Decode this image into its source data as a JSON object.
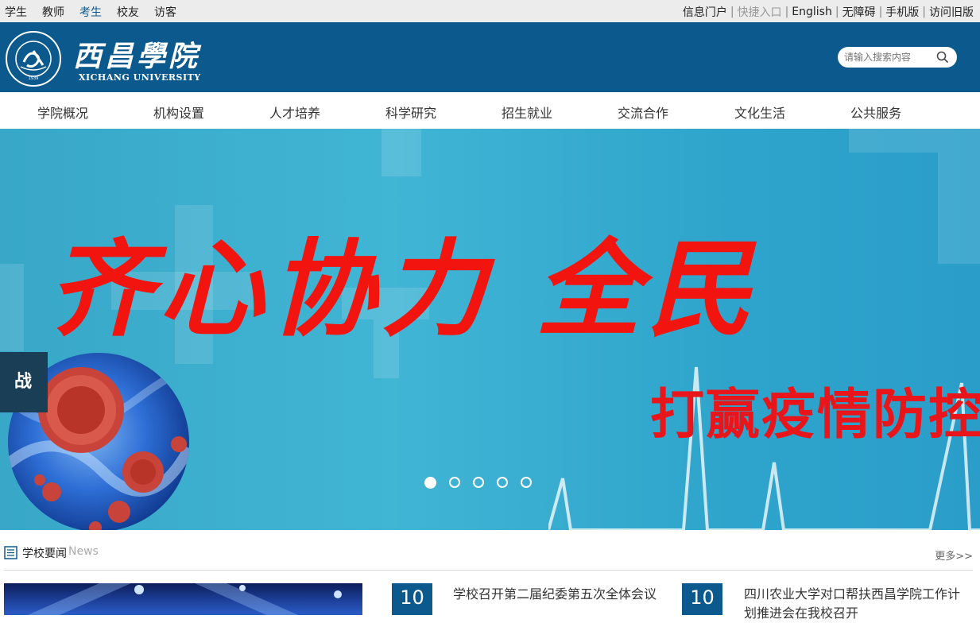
{
  "topbar": {
    "left_links": [
      "学生",
      "教师",
      "考生",
      "校友",
      "访客"
    ],
    "active_left": "考生",
    "right_links": [
      {
        "label": "信息门户",
        "dim": false
      },
      {
        "label": "快捷入口",
        "dim": true
      },
      {
        "label": "English",
        "dim": false
      },
      {
        "label": "无障碍",
        "dim": false
      },
      {
        "label": "手机版",
        "dim": false
      },
      {
        "label": "访问旧版",
        "dim": false
      }
    ]
  },
  "header": {
    "logo_cn": "西昌學院",
    "logo_en": "XICHANG UNIVERSITY",
    "emblem_year": "1939",
    "search_placeholder": "请输入搜索内容"
  },
  "nav": [
    "学院概况",
    "机构设置",
    "人才培养",
    "科学研究",
    "招生就业",
    "交流合作",
    "文化生活",
    "公共服务"
  ],
  "banner": {
    "title": "齐心协力 全民",
    "subtitle": "打赢疫情防控阻",
    "tag": "战疫",
    "slides_count": 5,
    "active_slide": 1
  },
  "news": {
    "title": "学校要闻",
    "title_en": "News",
    "more": "更多>>",
    "items": [
      {
        "day": "10",
        "title": "学校召开第二届纪委第五次全体会议"
      },
      {
        "day": "10",
        "title": "四川农业大学对口帮扶西昌学院工作计划推进会在我校召开"
      }
    ]
  },
  "colors": {
    "brand_blue": "#0c5a8d",
    "banner_red": "#f2150f"
  }
}
